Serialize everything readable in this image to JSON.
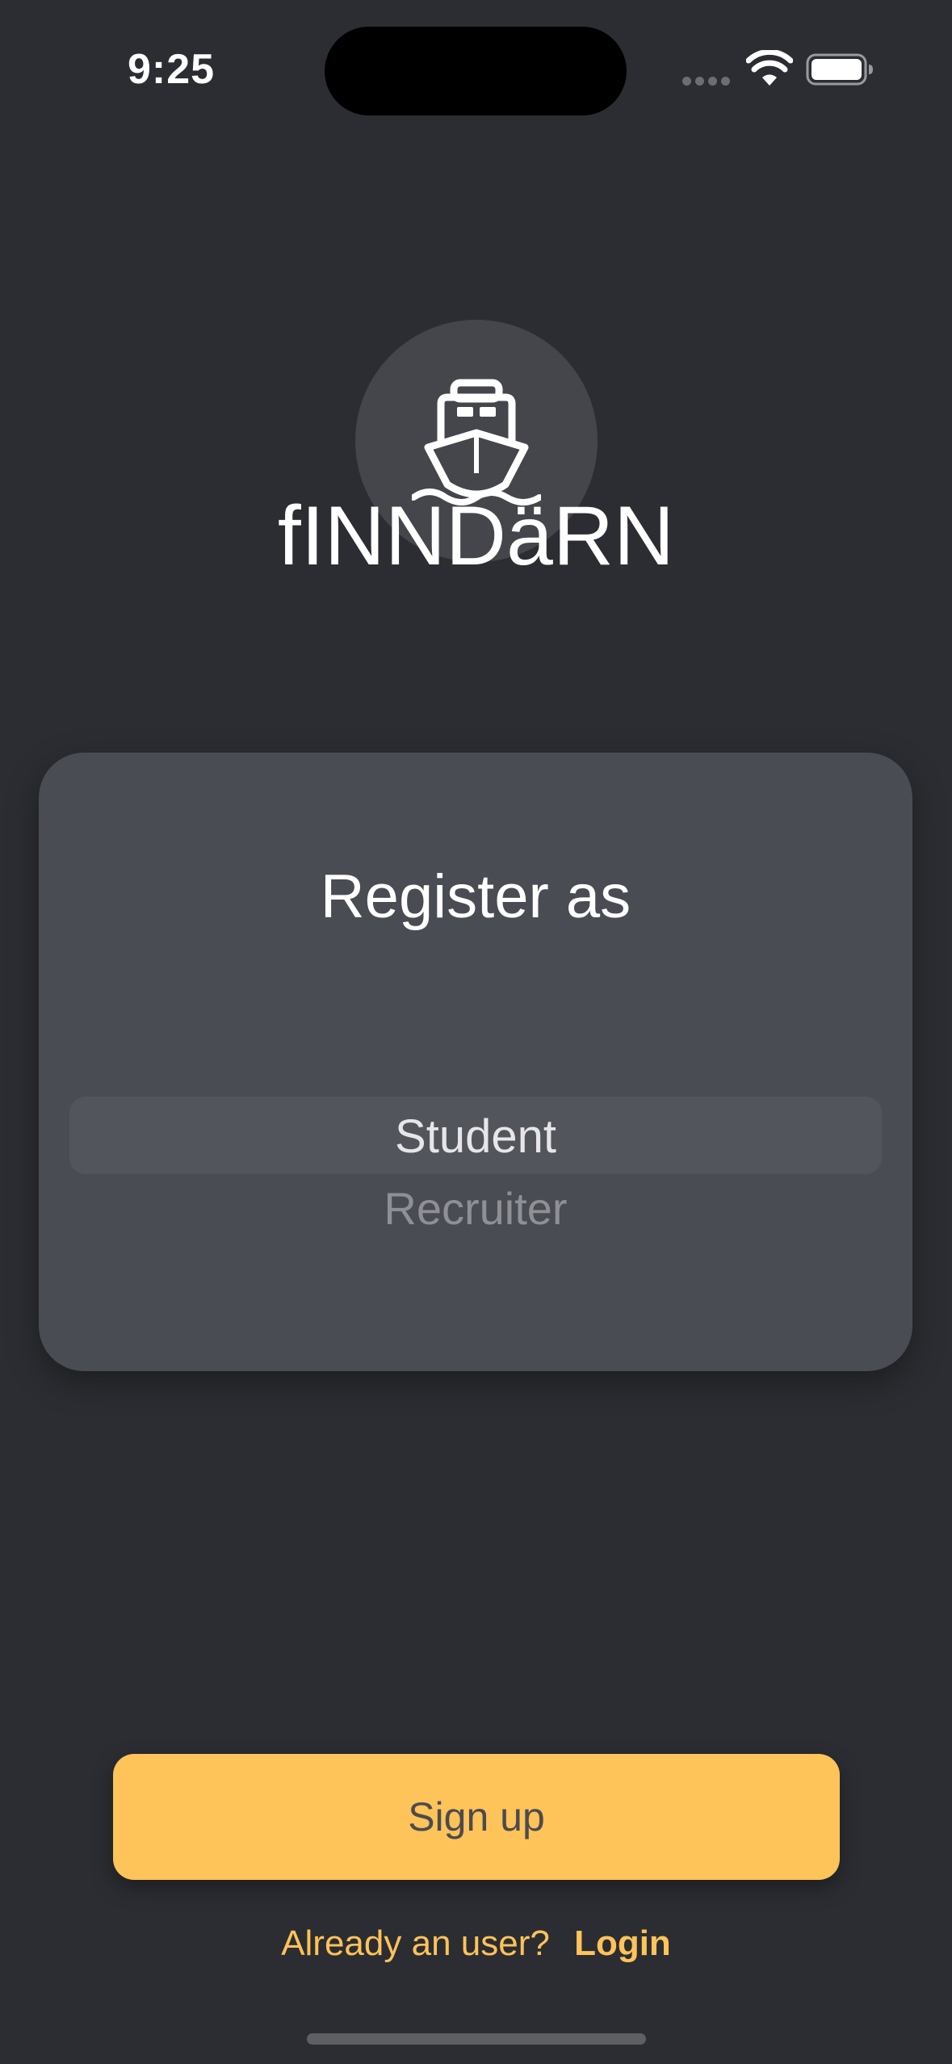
{
  "status_bar": {
    "time": "9:25"
  },
  "logo": {
    "icon": "ship-icon",
    "app_name": "fINNDäRN"
  },
  "register_card": {
    "title": "Register as",
    "options": [
      "Student",
      "Recruiter"
    ],
    "selected": "Student"
  },
  "actions": {
    "signup_label": "Sign up",
    "login_prompt": "Already an user?",
    "login_label": "Login"
  },
  "colors": {
    "background": "#2c2d32",
    "card": "#4a4c53",
    "accent": "#fec359"
  }
}
